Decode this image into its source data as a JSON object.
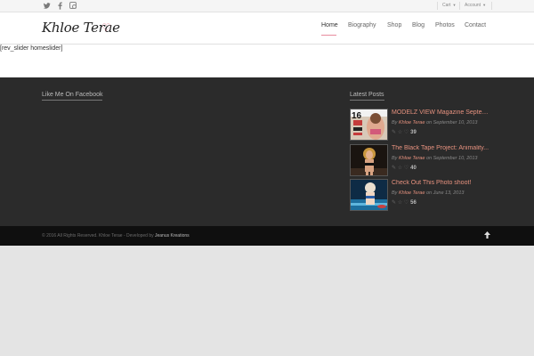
{
  "topbar": {
    "social": [
      "twitter-icon",
      "facebook-icon",
      "instagram-icon"
    ],
    "cart_label": "Cart",
    "account_label": "Account"
  },
  "header": {
    "logo_text": "Khloe Terae",
    "logo_symbol": "♡",
    "nav": [
      "Home",
      "Biography",
      "Shop",
      "Blog",
      "Photos",
      "Contact"
    ],
    "active_index": 0,
    "accent_color": "#e88c9e"
  },
  "main": {
    "shortcode": "[rev_slider homeslider]"
  },
  "footer": {
    "left_heading": "Like Me On Facebook",
    "right_heading": "Latest Posts",
    "posts": [
      {
        "title": "MODELZ VIEW Magazine Septemb...",
        "by": "By",
        "author": "Khloe Terae",
        "on": "on September 10, 2013",
        "likes": "39"
      },
      {
        "title": "The Black Tape Project: Animality...",
        "by": "By",
        "author": "Khloe Terae",
        "on": "on September 10, 2013",
        "likes": "40"
      },
      {
        "title": "Check Out This Photo shoot!",
        "by": "By",
        "author": "Khloe Terae",
        "on": "on June 13, 2013",
        "likes": "56"
      }
    ]
  },
  "socket": {
    "copyright": "© 2016 All Rights Reserved. Khloe Terae - Developed by",
    "developer": "Jeanus Kreations",
    "up_icon": "arrow-up-icon"
  }
}
